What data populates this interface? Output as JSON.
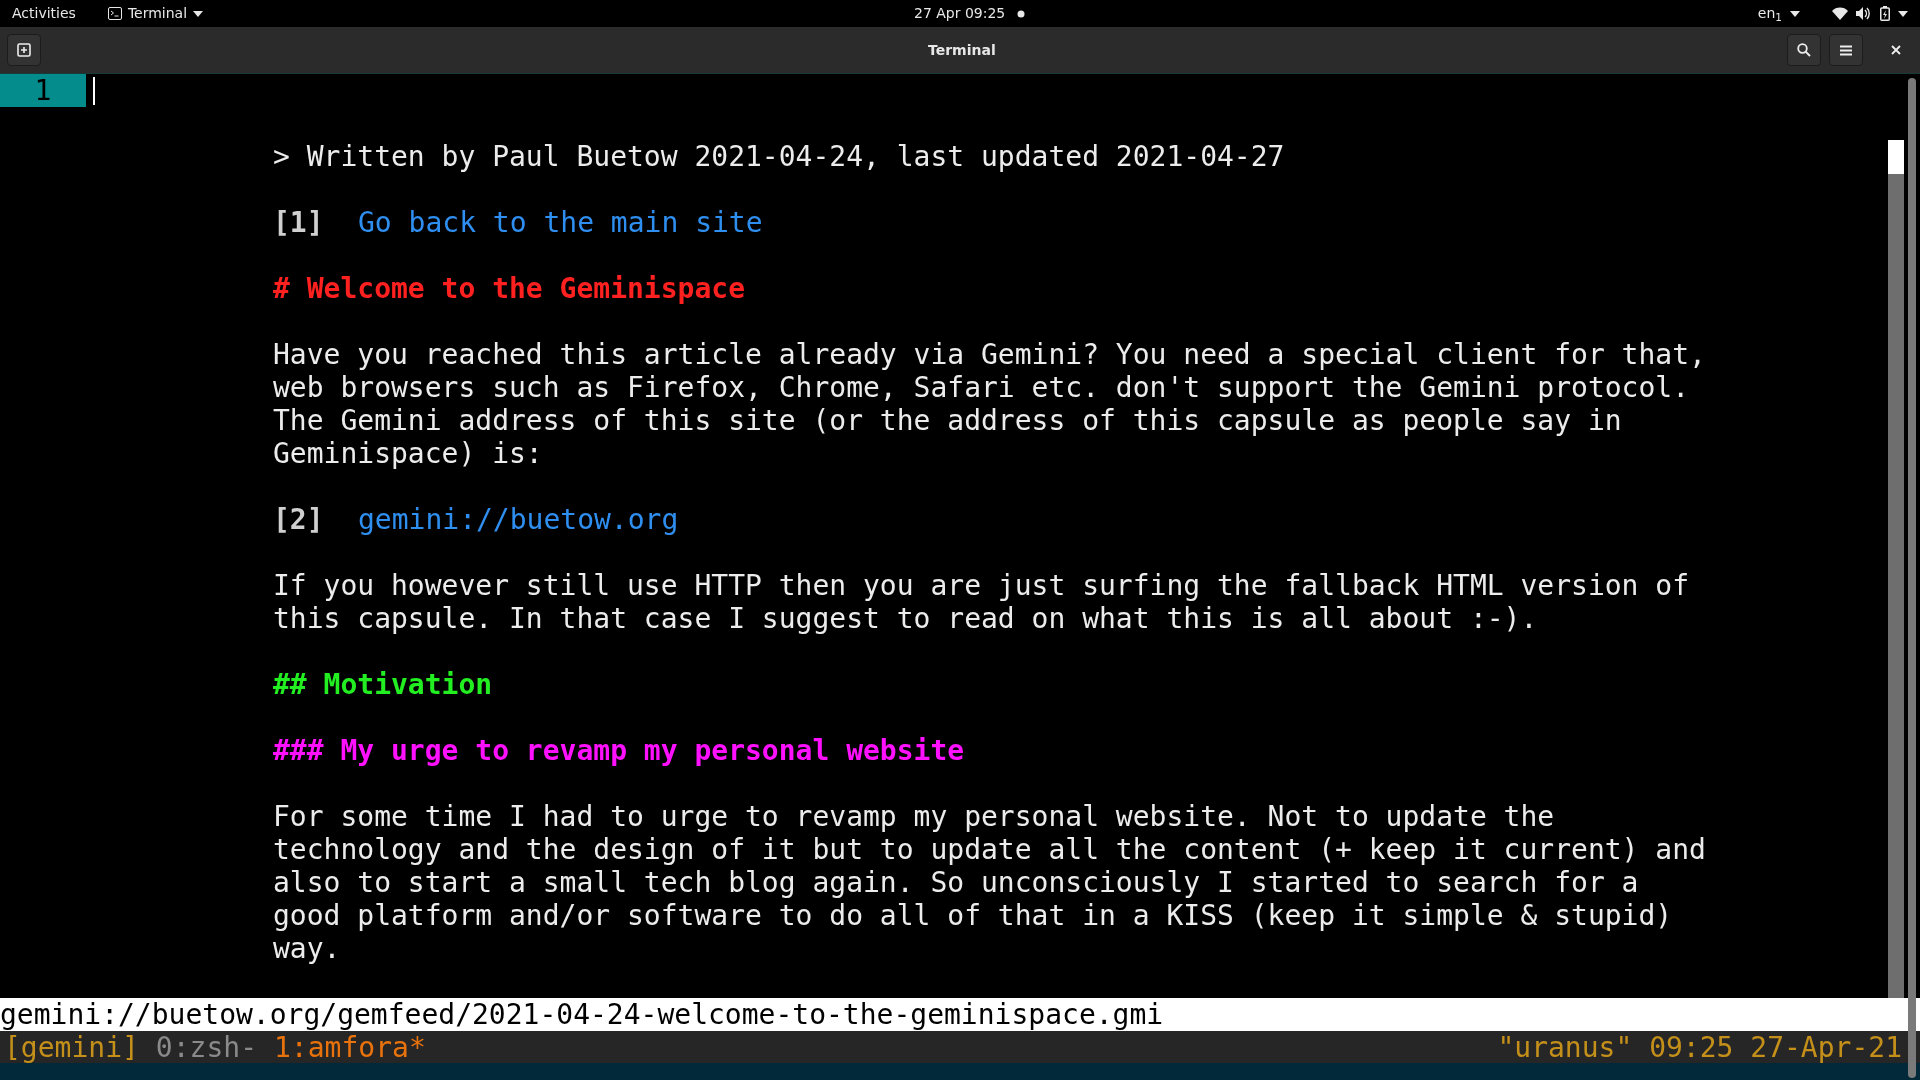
{
  "top_bar": {
    "activities": "Activities",
    "app_menu": "Terminal",
    "clock": "27 Apr 09:25",
    "input_source": "en$_{1}$"
  },
  "window": {
    "title": "Terminal"
  },
  "terminal": {
    "tab_number": "1",
    "blocks": [
      {
        "kind": "blank"
      },
      {
        "kind": "quote",
        "lines": [
          "> Written by Paul Buetow 2021-04-24, last updated 2021-04-27"
        ]
      },
      {
        "kind": "blank"
      },
      {
        "kind": "link",
        "label": "[1]",
        "text": "Go back to the main site"
      },
      {
        "kind": "blank"
      },
      {
        "kind": "h1",
        "lines": [
          "# Welcome to the Geminispace"
        ]
      },
      {
        "kind": "blank"
      },
      {
        "kind": "text",
        "lines": [
          "Have you reached this article already via Gemini? You need a special client for that,",
          "web browsers such as Firefox, Chrome, Safari etc. don't support the Gemini protocol.",
          "The Gemini address of this site (or the address of this capsule as people say in",
          "Geminispace) is:"
        ]
      },
      {
        "kind": "blank"
      },
      {
        "kind": "link",
        "label": "[2]",
        "text": "gemini://buetow.org"
      },
      {
        "kind": "blank"
      },
      {
        "kind": "text",
        "lines": [
          "If you however still use HTTP then you are just surfing the fallback HTML version of",
          "this capsule. In that case I suggest to read on what this is all about :-)."
        ]
      },
      {
        "kind": "blank"
      },
      {
        "kind": "h2",
        "lines": [
          "## Motivation"
        ]
      },
      {
        "kind": "blank"
      },
      {
        "kind": "h3",
        "lines": [
          "### My urge to revamp my personal website"
        ]
      },
      {
        "kind": "blank"
      },
      {
        "kind": "text",
        "lines": [
          "For some time I had to urge to revamp my personal website. Not to update the",
          "technology and the design of it but to update all the content (+ keep it current) and",
          "also to start a small tech blog again. So unconsciously I started to search for a",
          "good platform and/or software to do all of that in a KISS (keep it simple & stupid)",
          "way."
        ]
      }
    ],
    "url": "gemini://buetow.org/gemfeed/2021-04-24-welcome-to-the-geminispace.gmi"
  },
  "tmux": {
    "session": "[gemini]",
    "windows": [
      {
        "label": "0:zsh-",
        "selected": false
      },
      {
        "label": "1:amfora*",
        "selected": true
      }
    ],
    "right": "\"uranus\" 09:25 27-Apr-21"
  }
}
